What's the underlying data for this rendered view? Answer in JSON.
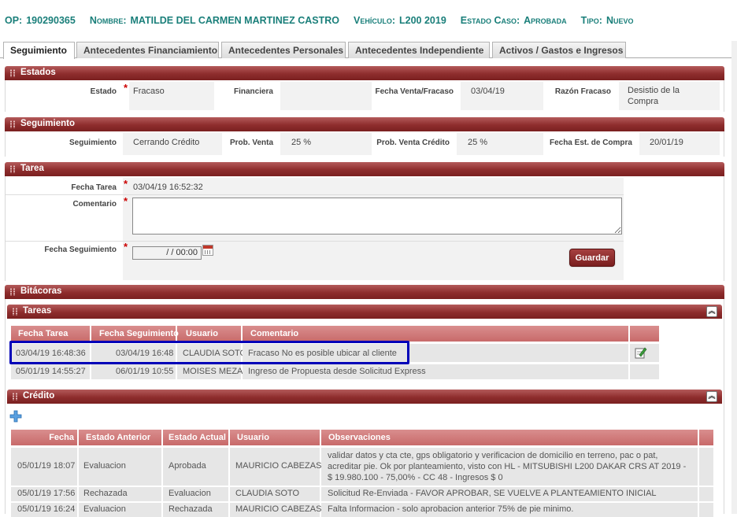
{
  "header": {
    "op_label": "OP:",
    "op_value": "190290365",
    "nombre_label": "Nombre:",
    "nombre_value": "MATILDE DEL CARMEN MARTINEZ CASTRO",
    "vehiculo_label": "Vehículo:",
    "vehiculo_value": "L200 2019",
    "estado_label": "Estado Caso:",
    "estado_value": "Aprobada",
    "tipo_label": "Tipo:",
    "tipo_value": "Nuevo"
  },
  "tabs": [
    {
      "label": "Seguimiento",
      "active": true
    },
    {
      "label": "Antecedentes Financiamiento"
    },
    {
      "label": "Antecedentes Personales"
    },
    {
      "label": "Antecedentes Independiente"
    },
    {
      "label": "Activos / Gastos e Ingresos"
    }
  ],
  "estados": {
    "title": "Estados",
    "estado_label": "Estado",
    "estado_value": "Fracaso",
    "financiera_label": "Financiera",
    "financiera_value": "",
    "fecha_label": "Fecha Venta/Fracaso",
    "fecha_value": "03/04/19",
    "razon_label": "Razón Fracaso",
    "razon_value": "Desistio de la Compra"
  },
  "seguimiento": {
    "title": "Seguimiento",
    "seg_label": "Seguimiento",
    "seg_value": "Cerrando Crédito",
    "prob_label": "Prob. Venta",
    "prob_value": "25 %",
    "probc_label": "Prob. Venta Crédito",
    "probc_value": "25 %",
    "fechaest_label": "Fecha Est. de Compra",
    "fechaest_value": "20/01/19"
  },
  "tarea": {
    "title": "Tarea",
    "fecha_label": "Fecha Tarea",
    "fecha_value": "03/04/19 16:52:32",
    "comentario_label": "Comentario",
    "comentario_value": "",
    "fecha_seg_label": "Fecha Seguimiento",
    "fecha_seg_value": "/ /  00:00",
    "guardar_label": "Guardar"
  },
  "bitacoras": {
    "title": "Bitácoras"
  },
  "tareas": {
    "title": "Tareas",
    "columns": [
      "Fecha Tarea",
      "Fecha Seguimiento",
      "Usuario",
      "Comentario"
    ],
    "rows": [
      [
        "03/04/19 16:48:36",
        "03/04/19 16:48",
        "CLAUDIA SOTO",
        "Fracaso No es posible ubicar al cliente"
      ],
      [
        "05/01/19 14:55:27",
        "06/01/19 10:55",
        "MOISES MEZA",
        "Ingreso de Propuesta desde Solicitud Express"
      ]
    ]
  },
  "credito": {
    "title": "Crédito",
    "columns": [
      "Fecha",
      "Estado Anterior",
      "Estado Actual",
      "Usuario",
      "Observaciones"
    ],
    "rows": [
      [
        "05/01/19 18:07",
        "Evaluacion",
        "Aprobada",
        "MAURICIO CABEZAS",
        "validar datos y cta cte, gps obligatorio y verificacion de domicilio en terreno, pac o pat, acreditar pie. Ok por planteamiento, visto con HL - MITSUBISHI L200 DAKAR CRS AT 2019 - $ 19.980.100 - 75,00% - CC 48 - Ingresos $ 0"
      ],
      [
        "05/01/19 17:56",
        "Rechazada",
        "Evaluacion",
        "CLAUDIA SOTO",
        "Solicitud Re-Enviada - FAVOR APROBAR, SE VUELVE A PLANTEAMIENTO INICIAL"
      ],
      [
        "05/01/19 16:24",
        "Evaluacion",
        "Rechazada",
        "MAURICIO CABEZAS",
        "Falta Informacion - solo aprobacion anterior 75% de pie minimo."
      ]
    ]
  },
  "colors": {
    "accent": "#1a7f7a",
    "bar": "#8e2d2d",
    "grid_head": "#c86a6a",
    "highlight": "#0000b8"
  }
}
